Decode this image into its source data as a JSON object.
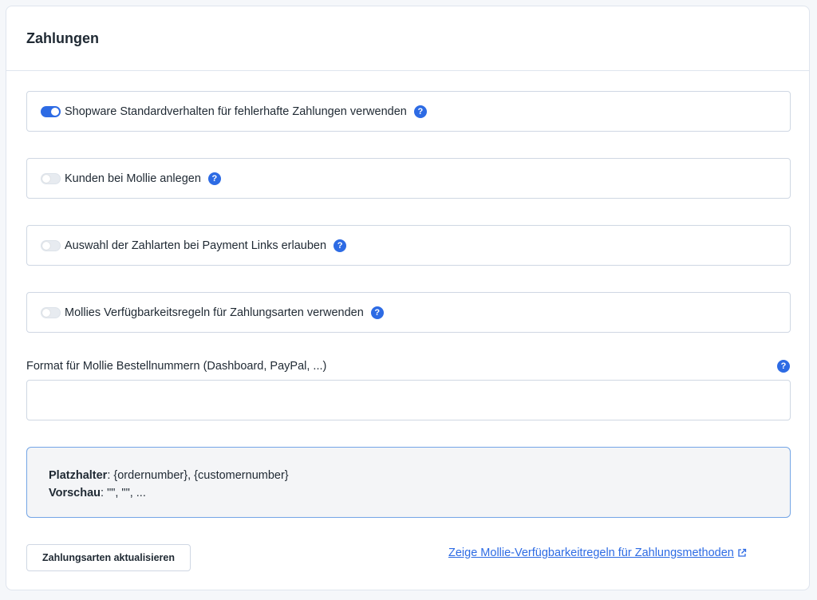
{
  "card": {
    "title": "Zahlungen"
  },
  "toggles": [
    {
      "label": "Shopware Standardverhalten für fehlerhafte Zahlungen verwenden",
      "checked": true
    },
    {
      "label": "Kunden bei Mollie anlegen",
      "checked": false
    },
    {
      "label": "Auswahl der Zahlarten bei Payment Links erlauben",
      "checked": false
    },
    {
      "label": "Mollies Verfügbarkeitsregeln für Zahlungsarten verwenden",
      "checked": false
    }
  ],
  "help_glyph": "?",
  "order_number_format": {
    "label": "Format für Mollie Bestellnummern (Dashboard, PayPal, ...)",
    "value": "",
    "placeholder": ""
  },
  "info": {
    "placeholder_label": "Platzhalter",
    "placeholder_value": ": {ordernumber}, {customernumber}",
    "preview_label": "Vorschau",
    "preview_value": ": \"\", \"\", ..."
  },
  "actions": {
    "update_button_label": "Zahlungsarten aktualisieren",
    "availability_link_label": "Zeige Mollie-Verfügbarkeitregeln für Zahlungsmethoden"
  },
  "icons": {
    "help": "help-icon",
    "external": "external-link-icon"
  },
  "colors": {
    "accent": "#2d6be4",
    "info_border": "#74a5e6",
    "info_background": "#f4f5f7"
  }
}
